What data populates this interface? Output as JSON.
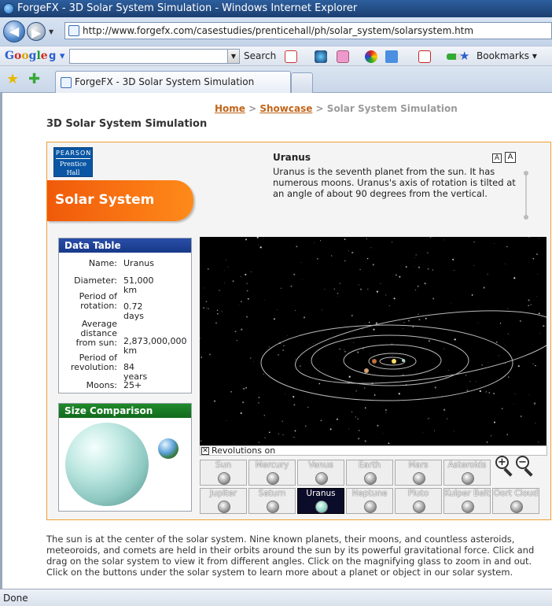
{
  "window": {
    "title": "ForgeFX - 3D Solar System Simulation - Windows Internet Explorer"
  },
  "address": {
    "url": "http://www.forgefx.com/casestudies/prenticehall/ph/solar_system/solarsystem.htm"
  },
  "google_bar": {
    "logo": "Google",
    "selector": "g ▾",
    "search_label": "Search",
    "bookmarks_label": "Bookmarks"
  },
  "tab": {
    "title": "ForgeFX - 3D Solar System Simulation"
  },
  "breadcrumb": {
    "home": "Home",
    "sep1": " > ",
    "showcase": "Showcase",
    "sep2": " > ",
    "current": "Solar System Simulation"
  },
  "page_title": "3D Solar System Simulation",
  "app": {
    "publisher_line1": "PEARSON",
    "publisher_line2": "Prentice",
    "publisher_line3": "Hall",
    "banner": "Solar System",
    "font_small": "A",
    "font_large": "A",
    "planet_name": "Uranus",
    "planet_description": "Uranus is the seventh planet from the sun. It has numerous moons. Uranus's axis of rotation is tilted at an angle of about 90 degrees from the vertical.",
    "data_table": {
      "title": "Data Table",
      "rows": [
        {
          "label": "Name:",
          "value": "Uranus"
        },
        {
          "label": "Diameter:",
          "value": "51,000 km"
        },
        {
          "label": "Period of rotation:",
          "value": "0.72 days"
        },
        {
          "label": "Average distance from sun:",
          "value": "2,873,000,000 km"
        },
        {
          "label": "Period of revolution:",
          "value": "84 years"
        },
        {
          "label": "Moons:",
          "value": "25+"
        }
      ]
    },
    "size_comparison": {
      "title": "Size Comparison"
    },
    "revolutions_label": "Revolutions on",
    "buttons_row1": [
      "Sun",
      "Mercury",
      "Venus",
      "Earth",
      "Mars",
      "Asteroids"
    ],
    "buttons_row2": [
      "Jupiter",
      "Saturn",
      "Uranus",
      "Neptune",
      "Pluto",
      "Kuiper Belt",
      "Oort Cloud"
    ],
    "selected": "Uranus"
  },
  "bottom_text": "The sun is at the center of the solar system. Nine known planets, their moons, and countless asteroids, meteoroids, and comets are held in their orbits around the sun by its powerful gravitational force. Click and drag on the solar system to view it from different angles. Click on the magnifying glass to zoom in and out. Click on the buttons under the solar system to learn more about a planet or object in our solar system.",
  "status": "Done",
  "colors": {
    "orange_accent": "#f07010",
    "table_head": "#1f4499",
    "size_head": "#1a7d25",
    "selected_button": "#0b0b2a"
  }
}
